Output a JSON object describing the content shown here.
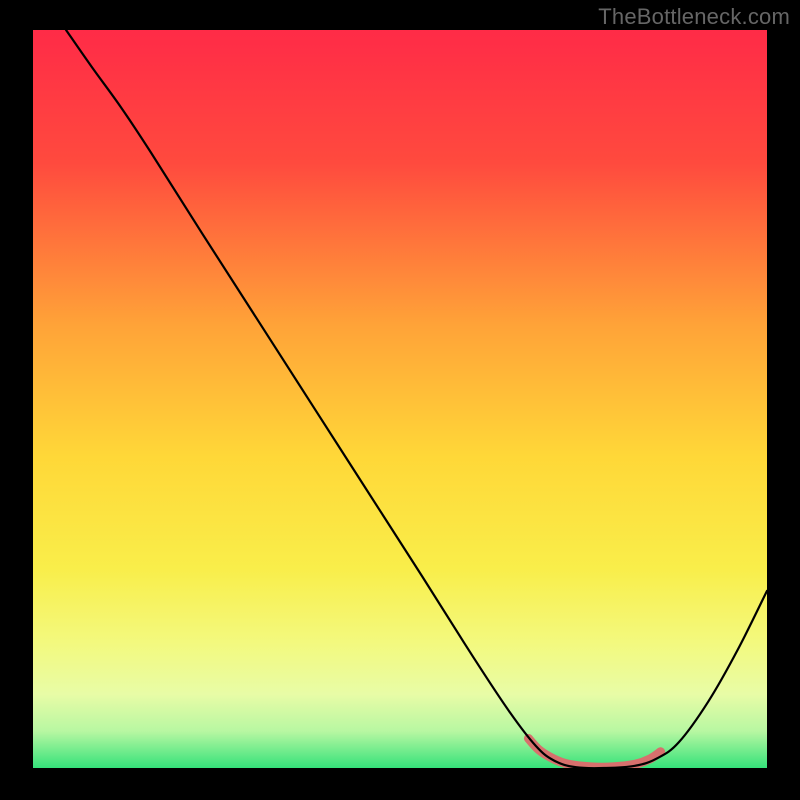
{
  "watermark": "TheBottleneck.com",
  "chart_data": {
    "type": "line",
    "title": "",
    "xlabel": "",
    "ylabel": "",
    "xlim": [
      0,
      100
    ],
    "ylim": [
      0,
      100
    ],
    "gradient_stops": [
      {
        "offset": 0,
        "color": "#ff2b47"
      },
      {
        "offset": 18,
        "color": "#ff4a3e"
      },
      {
        "offset": 40,
        "color": "#ffa338"
      },
      {
        "offset": 58,
        "color": "#ffd838"
      },
      {
        "offset": 73,
        "color": "#f9ee4a"
      },
      {
        "offset": 83,
        "color": "#f3f97e"
      },
      {
        "offset": 90,
        "color": "#e8fca6"
      },
      {
        "offset": 95,
        "color": "#b8f7a2"
      },
      {
        "offset": 100,
        "color": "#35e27a"
      }
    ],
    "series": [
      {
        "name": "bottleneck-curve",
        "stroke": "#000000",
        "stroke_width": 2.2,
        "points": [
          {
            "x": 4.5,
            "y": 100.0
          },
          {
            "x": 8.0,
            "y": 95.0
          },
          {
            "x": 12.0,
            "y": 89.5
          },
          {
            "x": 16.0,
            "y": 83.5
          },
          {
            "x": 23.0,
            "y": 72.5
          },
          {
            "x": 33.0,
            "y": 57.0
          },
          {
            "x": 43.0,
            "y": 41.5
          },
          {
            "x": 53.0,
            "y": 26.0
          },
          {
            "x": 60.0,
            "y": 15.0
          },
          {
            "x": 65.0,
            "y": 7.5
          },
          {
            "x": 68.5,
            "y": 3.0
          },
          {
            "x": 71.0,
            "y": 1.0
          },
          {
            "x": 74.0,
            "y": 0.1
          },
          {
            "x": 78.0,
            "y": 0.0
          },
          {
            "x": 82.0,
            "y": 0.3
          },
          {
            "x": 85.0,
            "y": 1.3
          },
          {
            "x": 88.0,
            "y": 3.5
          },
          {
            "x": 92.0,
            "y": 9.0
          },
          {
            "x": 96.0,
            "y": 16.0
          },
          {
            "x": 100.0,
            "y": 24.0
          }
        ]
      },
      {
        "name": "highlight-band",
        "stroke": "#d7706d",
        "stroke_width": 9,
        "points": [
          {
            "x": 67.5,
            "y": 4.0
          },
          {
            "x": 69.0,
            "y": 2.4
          },
          {
            "x": 71.0,
            "y": 1.2
          },
          {
            "x": 73.0,
            "y": 0.5
          },
          {
            "x": 76.0,
            "y": 0.15
          },
          {
            "x": 79.0,
            "y": 0.15
          },
          {
            "x": 82.0,
            "y": 0.5
          },
          {
            "x": 84.0,
            "y": 1.2
          },
          {
            "x": 85.5,
            "y": 2.2
          }
        ]
      }
    ]
  }
}
